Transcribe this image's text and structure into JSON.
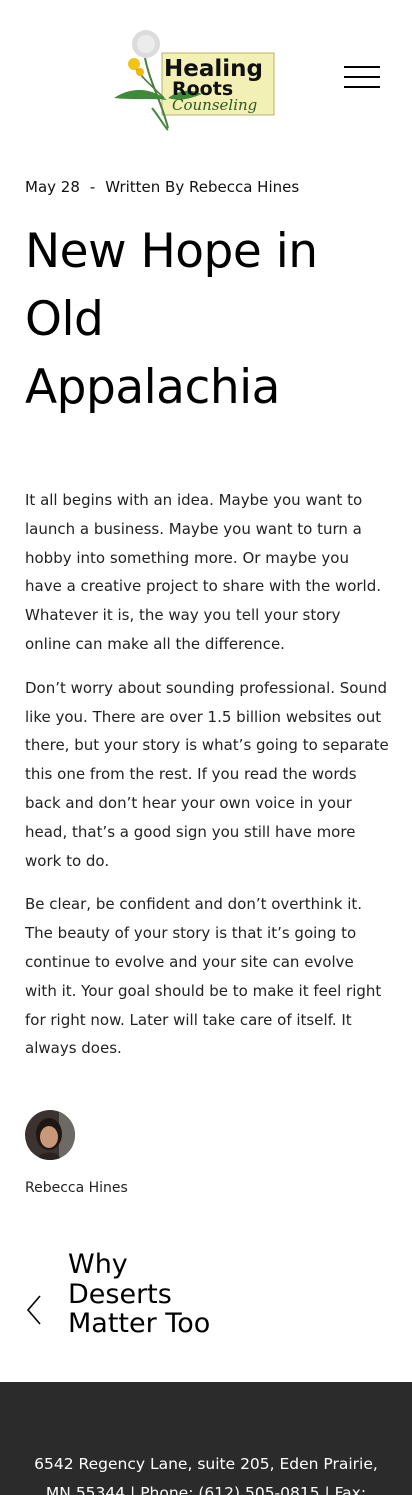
{
  "header": {
    "logo": {
      "line1": "Healing",
      "line2": "Roots",
      "line3": "Counseling"
    },
    "menu_icon": "hamburger-icon"
  },
  "post": {
    "date": "May 28",
    "separator": "-",
    "byline": "Written By Rebecca Hines",
    "title": "New Hope in Old Appalachia",
    "paragraphs": [
      "It all begins with an idea. Maybe you want to launch a business. Maybe you want to turn a hobby into something more. Or maybe you have a creative project to share with the world. Whatever it is, the way you tell your story online can make all the difference.",
      "Don’t worry about sounding professional. Sound like you. There are over 1.5 billion websites out there, but your story is what’s going to separate this one from the rest. If you read the words back and don’t hear your own voice in your head, that’s a good sign you still have more work to do.",
      "Be clear, be confident and don’t overthink it. The beauty of your story is that it’s going to continue to evolve and your site can evolve with it. Your goal should be to make it feel right for right now. Later will take care of itself. It always does."
    ],
    "author": {
      "name": "Rebecca Hines"
    }
  },
  "pagination": {
    "prev_icon": "chevron-left-icon",
    "prev_title": "Why Deserts Matter Too"
  },
  "footer": {
    "address_text": "6542 Regency Lane, suite 205, Eden Prairie, MN 55344  |  Phone: (612) 505-0815  |  Fax:"
  },
  "colors": {
    "footer_bg": "#2b2b2b",
    "logo_box": "#f3f0b5",
    "logo_green": "#3f8a3a",
    "dandelion_yellow": "#f2c418"
  }
}
